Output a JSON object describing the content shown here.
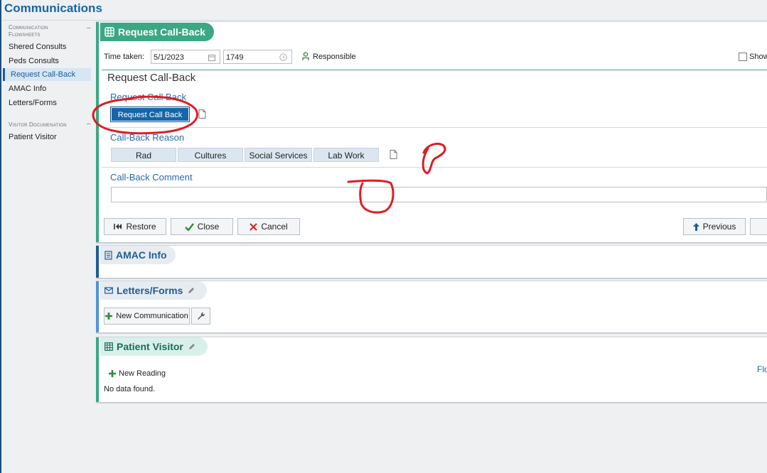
{
  "app": {
    "title": "Communications"
  },
  "sidebar": {
    "sections": [
      {
        "heading": "Communication Flowsheets",
        "toggle": "–",
        "items": [
          "Shered Consults",
          "Peds Consults",
          "Request Call-Back",
          "AMAC Info",
          "Letters/Forms"
        ]
      },
      {
        "heading": "Visitor Documenation",
        "toggle": "–",
        "items": [
          "Patient Visitor"
        ]
      }
    ]
  },
  "callback": {
    "title": "Request Call-Back",
    "time_taken_label": "Time taken:",
    "date": "5/1/2023",
    "time": "1749",
    "responsible_label": "Responsible",
    "show_label": "Show",
    "section_title": "Request Call-Back",
    "request_label": "Request Call Back",
    "request_button": "Request Call Back",
    "reason_label": "Call-Back Reason",
    "reasons": [
      "Rad",
      "Cultures",
      "Social Services",
      "Lab Work"
    ],
    "comment_label": "Call-Back Comment",
    "comment_value": "",
    "restore": "Restore",
    "close": "Close",
    "cancel": "Cancel",
    "previous": "Previous"
  },
  "amac": {
    "title": "AMAC Info"
  },
  "letters": {
    "title": "Letters/Forms",
    "new_comm": "New Communication"
  },
  "visitor": {
    "title": "Patient Visitor",
    "new_reading": "New Reading",
    "empty": "No data found.",
    "right_link": "Flo"
  },
  "colors": {
    "accent_blue": "#1566a8",
    "teal": "#3aa882",
    "annotation_red": "#e01b24"
  }
}
